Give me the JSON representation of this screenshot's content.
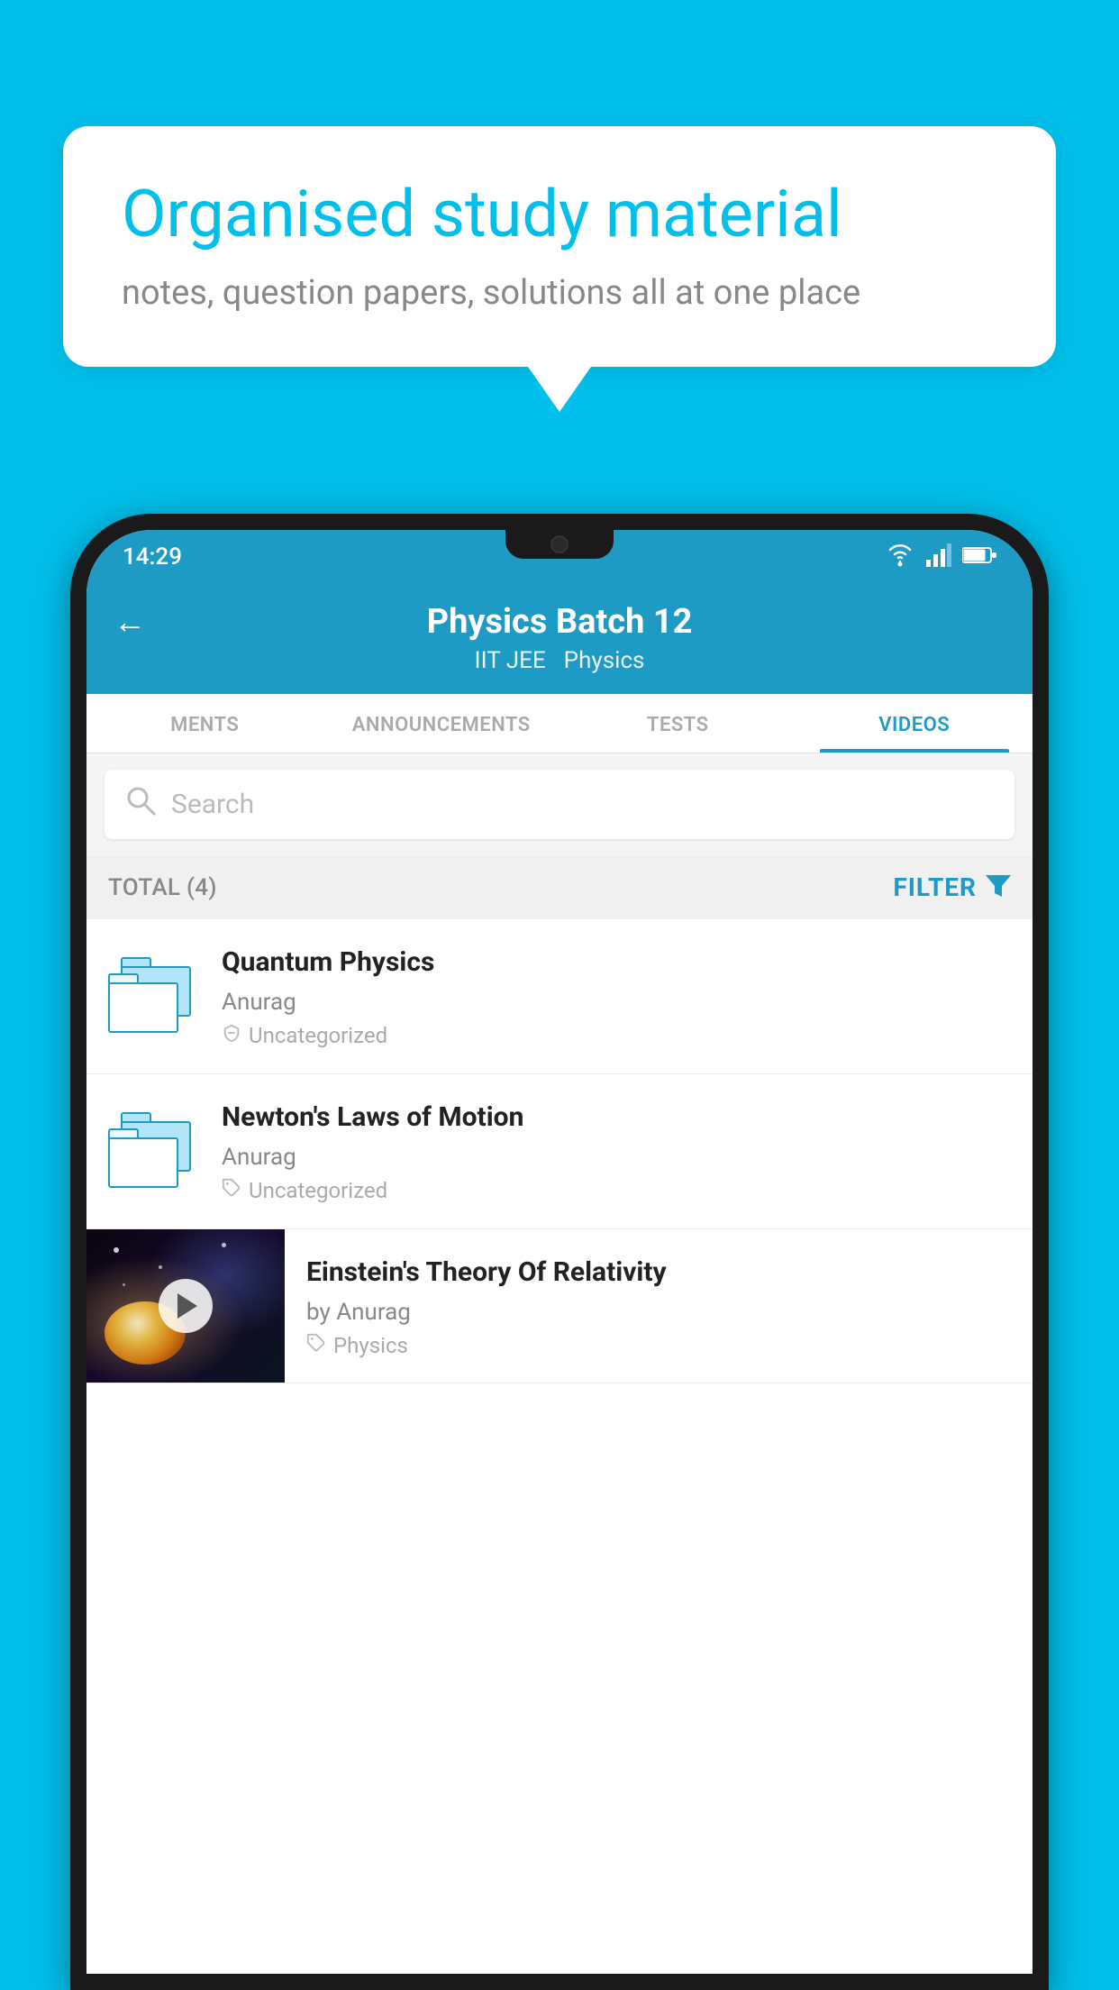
{
  "background_color": "#00BFEA",
  "speech_bubble": {
    "title": "Organised study material",
    "subtitle": "notes, question papers, solutions all at one place"
  },
  "status_bar": {
    "time": "14:29"
  },
  "app_bar": {
    "title": "Physics Batch 12",
    "subtitle1": "IIT JEE",
    "subtitle2": "Physics",
    "back_label": "←"
  },
  "tabs": [
    {
      "label": "MENTS",
      "active": false
    },
    {
      "label": "ANNOUNCEMENTS",
      "active": false
    },
    {
      "label": "TESTS",
      "active": false
    },
    {
      "label": "VIDEOS",
      "active": true
    }
  ],
  "search": {
    "placeholder": "Search"
  },
  "filter_bar": {
    "total_label": "TOTAL (4)",
    "filter_label": "FILTER"
  },
  "videos": [
    {
      "title": "Quantum Physics",
      "author": "Anurag",
      "tag": "Uncategorized",
      "type": "folder"
    },
    {
      "title": "Newton's Laws of Motion",
      "author": "Anurag",
      "tag": "Uncategorized",
      "type": "folder"
    },
    {
      "title": "Einstein's Theory Of Relativity",
      "author": "by Anurag",
      "tag": "Physics",
      "type": "video"
    }
  ]
}
